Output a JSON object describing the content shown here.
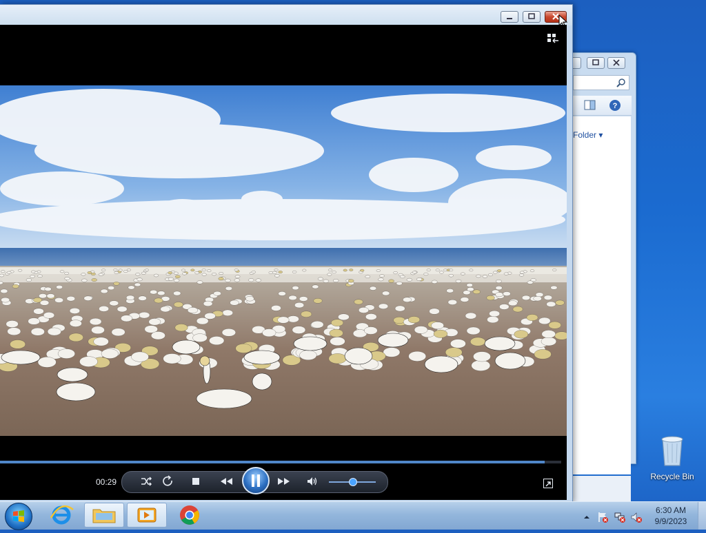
{
  "player": {
    "time": "00:29",
    "progress_fraction": 0.97,
    "volume_fraction": 0.5,
    "icons": {
      "shuffle": "shuffle-icon",
      "repeat": "repeat-icon",
      "stop": "stop-icon",
      "previous": "previous-icon",
      "play_pause": "pause-icon",
      "next": "next-icon",
      "mute": "speaker-icon",
      "fullscreen": "fullscreen-icon",
      "switch_library": "switch-to-library-icon"
    }
  },
  "explorer": {
    "folder_link": "Folder ▾"
  },
  "desktop": {
    "recycle_bin_label": "Recycle Bin"
  },
  "taskbar": {
    "clock_time": "6:30 AM",
    "clock_date": "9/9/2023"
  },
  "colors": {
    "accent": "#4f86c8",
    "close_button": "#c9492f"
  }
}
